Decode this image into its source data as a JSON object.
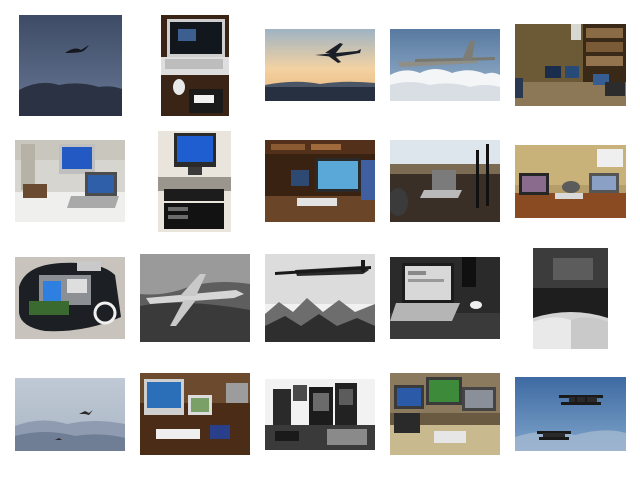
{
  "gallery": {
    "thumbnails": [
      {
        "subject": "bird-in-sky"
      },
      {
        "subject": "laptop-on-desk"
      },
      {
        "subject": "airplane-at-sunset"
      },
      {
        "subject": "military-plane-above-clouds"
      },
      {
        "subject": "corner-desk-with-computers"
      },
      {
        "subject": "desk-with-monitor-and-laptop"
      },
      {
        "subject": "desktop-pc-tower"
      },
      {
        "subject": "study-room-workstation"
      },
      {
        "subject": "laptop-by-window"
      },
      {
        "subject": "office-desk-with-laptops"
      },
      {
        "subject": "open-bag-with-gadgets"
      },
      {
        "subject": "airliner-over-city"
      },
      {
        "subject": "bomber-over-mountains"
      },
      {
        "subject": "laptop-monochrome"
      },
      {
        "subject": "open-book-blurred"
      },
      {
        "subject": "birds-over-hills"
      },
      {
        "subject": "desk-with-imac"
      },
      {
        "subject": "vintage-electronics"
      },
      {
        "subject": "office-cubicle"
      },
      {
        "subject": "biplanes-in-sky"
      }
    ]
  }
}
